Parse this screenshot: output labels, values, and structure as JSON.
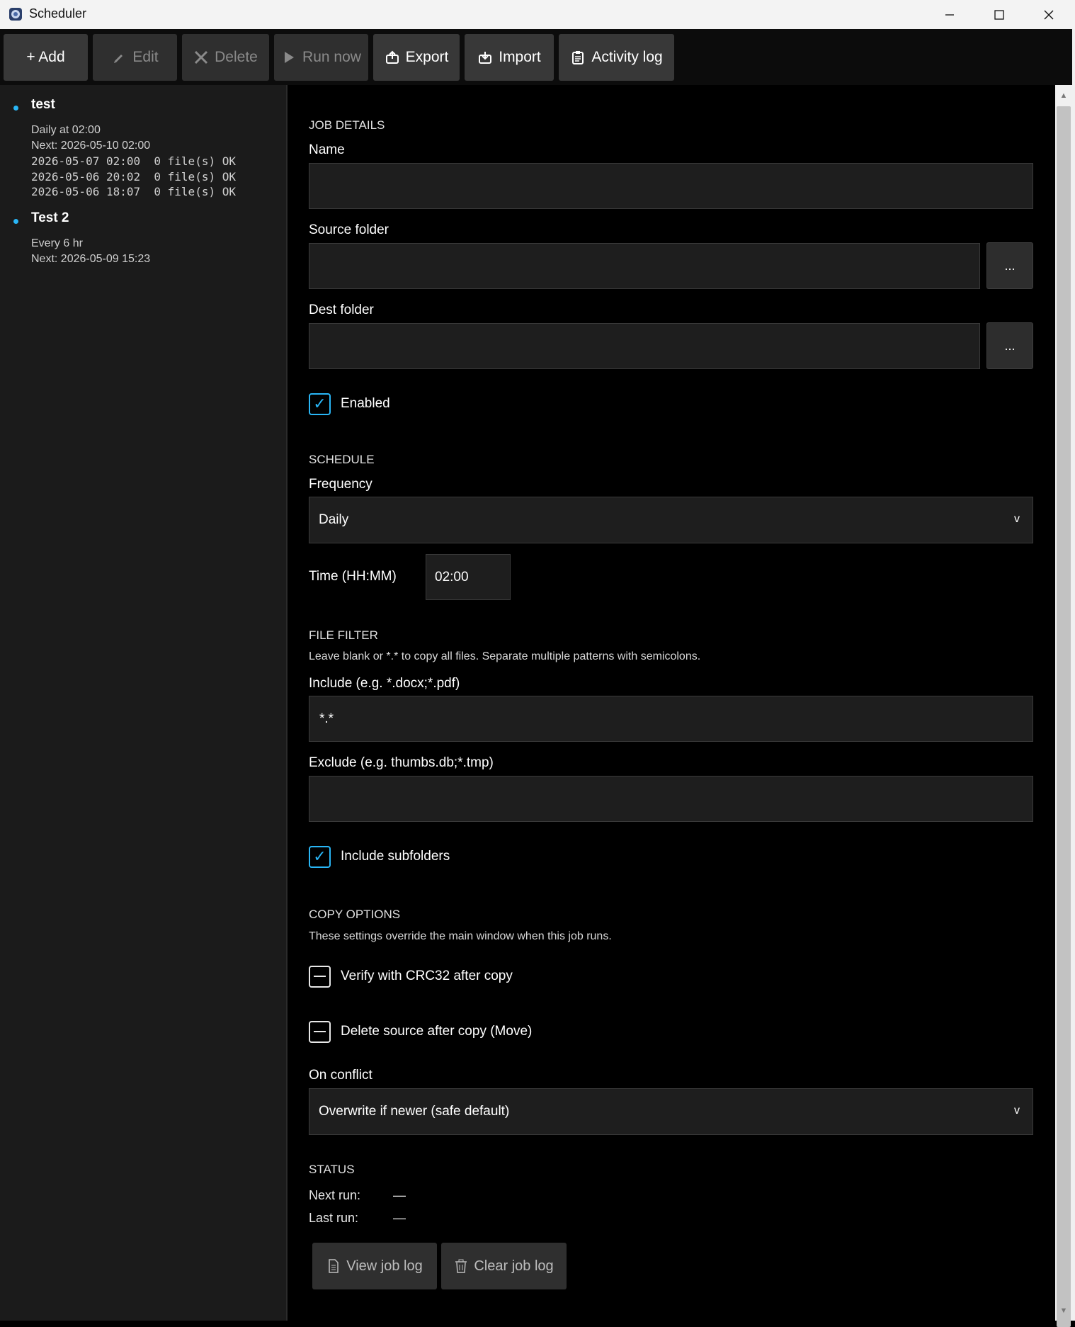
{
  "window": {
    "title": "Scheduler"
  },
  "toolbar": {
    "add": "+ Add",
    "edit": "Edit",
    "delete": "Delete",
    "run_now": "Run now",
    "export": "Export",
    "import": "Import",
    "activity_log": "Activity log"
  },
  "jobs": [
    {
      "name": "test",
      "schedule": "Daily at 02:00",
      "next": "Next: 2026-05-10 02:00",
      "log": [
        "2026-05-07 02:00  0 file(s) OK",
        "2026-05-06 20:02  0 file(s) OK",
        "2026-05-06 18:07  0 file(s) OK"
      ]
    },
    {
      "name": "Test 2",
      "schedule": "Every 6 hr",
      "next": "Next: 2026-05-09 15:23",
      "log": []
    }
  ],
  "job_details": {
    "section": "JOB DETAILS",
    "name_label": "Name",
    "name_value": "",
    "source_label": "Source folder",
    "source_value": "",
    "dest_label": "Dest folder",
    "dest_value": "",
    "browse": "...",
    "enabled_label": "Enabled",
    "enabled": true
  },
  "schedule": {
    "section": "SCHEDULE",
    "frequency_label": "Frequency",
    "frequency_value": "Daily",
    "chevron": "v",
    "time_label": "Time (HH:MM)",
    "time_value": "02:00"
  },
  "file_filter": {
    "section": "FILE FILTER",
    "hint": "Leave blank or *.* to copy all files. Separate multiple patterns with semicolons.",
    "include_label": "Include (e.g. *.docx;*.pdf)",
    "include_value": "*.*",
    "exclude_label": "Exclude (e.g. thumbs.db;*.tmp)",
    "exclude_value": "",
    "subfolders_label": "Include subfolders",
    "subfolders": true
  },
  "copy_options": {
    "section": "COPY OPTIONS",
    "hint": "These settings override the main window when this job runs.",
    "verify_label": "Verify with CRC32 after copy",
    "move_label": "Delete source after copy (Move)",
    "conflict_label": "On conflict",
    "conflict_value": "Overwrite if newer (safe default)"
  },
  "status": {
    "section": "STATUS",
    "next_run_label": "Next run:",
    "next_run_value": "—",
    "last_run_label": "Last run:",
    "last_run_value": "—",
    "view_log": "View job log",
    "clear_log": "Clear job log"
  },
  "colors": {
    "accent": "#29b6f6",
    "background": "#000000",
    "sidebar": "#1b1b1b",
    "button": "#383838"
  }
}
